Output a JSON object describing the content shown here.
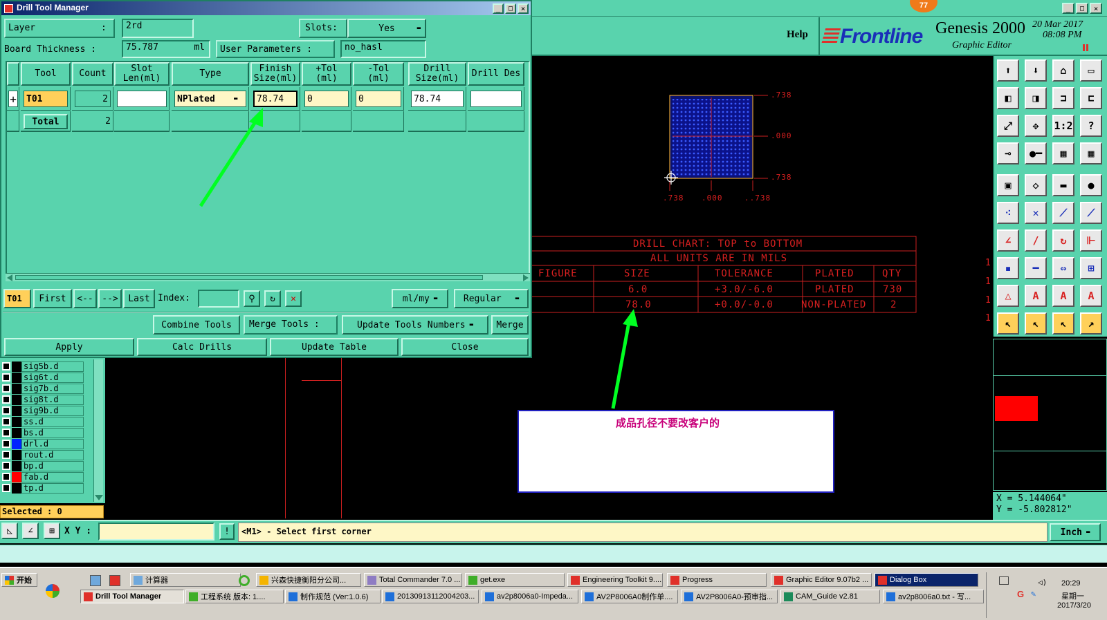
{
  "dialog": {
    "title": "Drill Tool Manager",
    "layer_label": "Layer",
    "layer_sep": ":",
    "layer_value": "2rd",
    "slots_label": "Slots:",
    "slots_value": "Yes",
    "board_thickness_label": "Board Thickness :",
    "board_thickness_value": "75.787",
    "board_thickness_unit": "ml",
    "user_params_label": "User Parameters :",
    "user_params_value": "no_hasl",
    "columns": [
      "Tool",
      "Count",
      "Slot Len(ml)",
      "Type",
      "Finish Size(ml)",
      "+Tol (ml)",
      "-Tol (ml)",
      "Drill Size(ml)",
      "Drill Des"
    ],
    "row": {
      "tool": "T01",
      "count": "2",
      "slot_len": "",
      "type": "NPlated",
      "finish": "78.74",
      "ptol": "0",
      "ntol": "0",
      "drill_size": "78.74",
      "drill_des": ""
    },
    "total": {
      "label": "Total",
      "count": "2"
    },
    "expand_glyph": "+",
    "nav": {
      "current": "T01",
      "first": "First",
      "prev": "<--",
      "next": "-->",
      "last": "Last",
      "index_label": "Index:",
      "index_value": "",
      "units": "ml/my",
      "mode": "Regular"
    },
    "actions1": {
      "combine": "Combine Tools",
      "merge_tools": "Merge Tools :",
      "update_numbers": "Update Tools Numbers",
      "merge": "Merge"
    },
    "actions2": {
      "apply": "Apply",
      "calc": "Calc Drills",
      "update_table": "Update Table",
      "close": "Close"
    },
    "title_btns": {
      "min": "_",
      "max": "□",
      "close": "×"
    }
  },
  "editor": {
    "help": "Help",
    "brand": "Frontline",
    "product": "Genesis 2000",
    "subtitle": "Graphic Editor",
    "date": "20 Mar 2017",
    "time": "08:08 PM",
    "badge": "77",
    "board_labels": {
      "top_right": ".738",
      "mid_right": ".000",
      "bot_right": ".738",
      "bot_left": ".738",
      "bot_mid": ".000",
      "bot_right2": "..738"
    },
    "chart": {
      "title1": "DRILL CHART: TOP to BOTTOM",
      "title2": "ALL UNITS ARE IN MILS",
      "headers": [
        "FIGURE",
        "SIZE",
        "TOLERANCE",
        "PLATED",
        "QTY"
      ],
      "rows": [
        [
          "",
          "6.0",
          "+3.0/-6.0",
          "PLATED",
          "730"
        ],
        [
          "",
          "78.0",
          "+0.0/-0.0",
          "NON-PLATED",
          "2"
        ]
      ]
    },
    "note": "成品孔径不要改客户的",
    "side_marks": [
      "1",
      "1",
      "1",
      "1"
    ],
    "coords": {
      "x": "X = 5.144064\"",
      "y": "Y = -5.802812\""
    },
    "prompt": "<M1> - Select first corner",
    "xy_label": "X Y :",
    "xy_value": "",
    "units_btn": "Inch",
    "selected": "Selected : 0",
    "colors": {
      "accent_green": "#00ff22",
      "chart_red": "#d82020",
      "note_text": "#c8007a"
    }
  },
  "layers": [
    {
      "name": "sig5b.d",
      "color": "#000000"
    },
    {
      "name": "sig6t.d",
      "color": "#000000"
    },
    {
      "name": "sig7b.d",
      "color": "#000000"
    },
    {
      "name": "sig8t.d",
      "color": "#000000"
    },
    {
      "name": "sig9b.d",
      "color": "#000000"
    },
    {
      "name": "ss.d",
      "color": "#000000"
    },
    {
      "name": "bs.d",
      "color": "#000000"
    },
    {
      "name": "drl.d",
      "color": "#0022ff"
    },
    {
      "name": "rout.d",
      "color": "#000000"
    },
    {
      "name": "bp.d",
      "color": "#000000"
    },
    {
      "name": "fab.d",
      "color": "#ff0000"
    },
    {
      "name": "tp.d",
      "color": "#000000"
    }
  ],
  "taskbar": {
    "start": "开始",
    "row1": [
      "计算器",
      "兴森快捷衡阳分公司...",
      "Total Commander 7.0 ...",
      "get.exe",
      "Engineering Toolkit 9....",
      "Progress",
      "Graphic Editor 9.07b2 ...",
      "Dialog Box"
    ],
    "row2": [
      "Drill Tool Manager",
      "工程系统  版本: 1....",
      "制作规范 (Ver:1.0.6)",
      "20130913112004203...",
      "av2p8006a0-Impeda...",
      "AV2P8006A0制作单....",
      "AV2P8006A0-预审指...",
      "CAM_Guide v2.81",
      "av2p8006a0.txt - 写..."
    ],
    "clock_time": "20:29",
    "clock_day": "星期一",
    "clock_date": "2017/3/20"
  }
}
